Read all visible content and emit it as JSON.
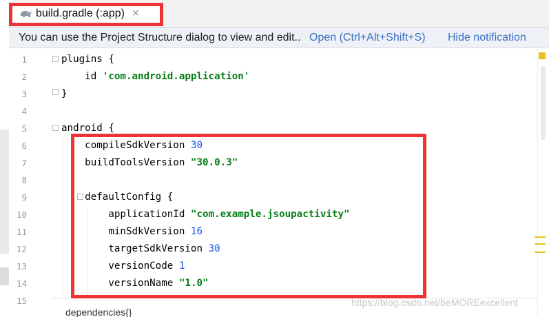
{
  "tab": {
    "icon": "gradle-elephant-icon",
    "label": "build.gradle (:app)",
    "close_glyph": "×"
  },
  "notification": {
    "message": "You can use the Project Structure dialog to view and edit..",
    "open_action": "Open (Ctrl+Alt+Shift+S)",
    "hide_action": "Hide notification"
  },
  "editor": {
    "line_numbers": [
      "1",
      "2",
      "3",
      "4",
      "5",
      "6",
      "7",
      "8",
      "9",
      "10",
      "11",
      "12",
      "13",
      "14",
      "15"
    ],
    "lines": [
      {
        "indent": "",
        "plain": "plugins {",
        "token": "",
        "token_type": ""
      },
      {
        "indent": "    ",
        "plain": "id ",
        "token": "'com.android.application'",
        "token_type": "str"
      },
      {
        "indent": "",
        "plain": "}",
        "token": "",
        "token_type": ""
      },
      {
        "indent": "",
        "plain": "",
        "token": "",
        "token_type": ""
      },
      {
        "indent": "",
        "plain": "android {",
        "token": "",
        "token_type": ""
      },
      {
        "indent": "    ",
        "plain": "compileSdkVersion ",
        "token": "30",
        "token_type": "num"
      },
      {
        "indent": "    ",
        "plain": "buildToolsVersion ",
        "token": "\"30.0.3\"",
        "token_type": "str"
      },
      {
        "indent": "",
        "plain": "",
        "token": "",
        "token_type": ""
      },
      {
        "indent": "    ",
        "plain": "defaultConfig {",
        "token": "",
        "token_type": ""
      },
      {
        "indent": "        ",
        "plain": "applicationId ",
        "token": "\"com.example.jsoupactivity\"",
        "token_type": "str"
      },
      {
        "indent": "        ",
        "plain": "minSdkVersion ",
        "token": "16",
        "token_type": "num"
      },
      {
        "indent": "        ",
        "plain": "targetSdkVersion ",
        "token": "30",
        "token_type": "num"
      },
      {
        "indent": "        ",
        "plain": "versionCode ",
        "token": "1",
        "token_type": "num"
      },
      {
        "indent": "        ",
        "plain": "versionName ",
        "token": "\"1.0\"",
        "token_type": "str"
      }
    ]
  },
  "breadcrumb": "dependencies{}",
  "watermark": "https://blog.csdn.net/beMOREexcellent",
  "colors": {
    "highlight_border": "#ee3236",
    "link": "#3a6fc4",
    "string": "#067d17",
    "number": "#1750eb",
    "warning_marker": "#e6c21a"
  }
}
